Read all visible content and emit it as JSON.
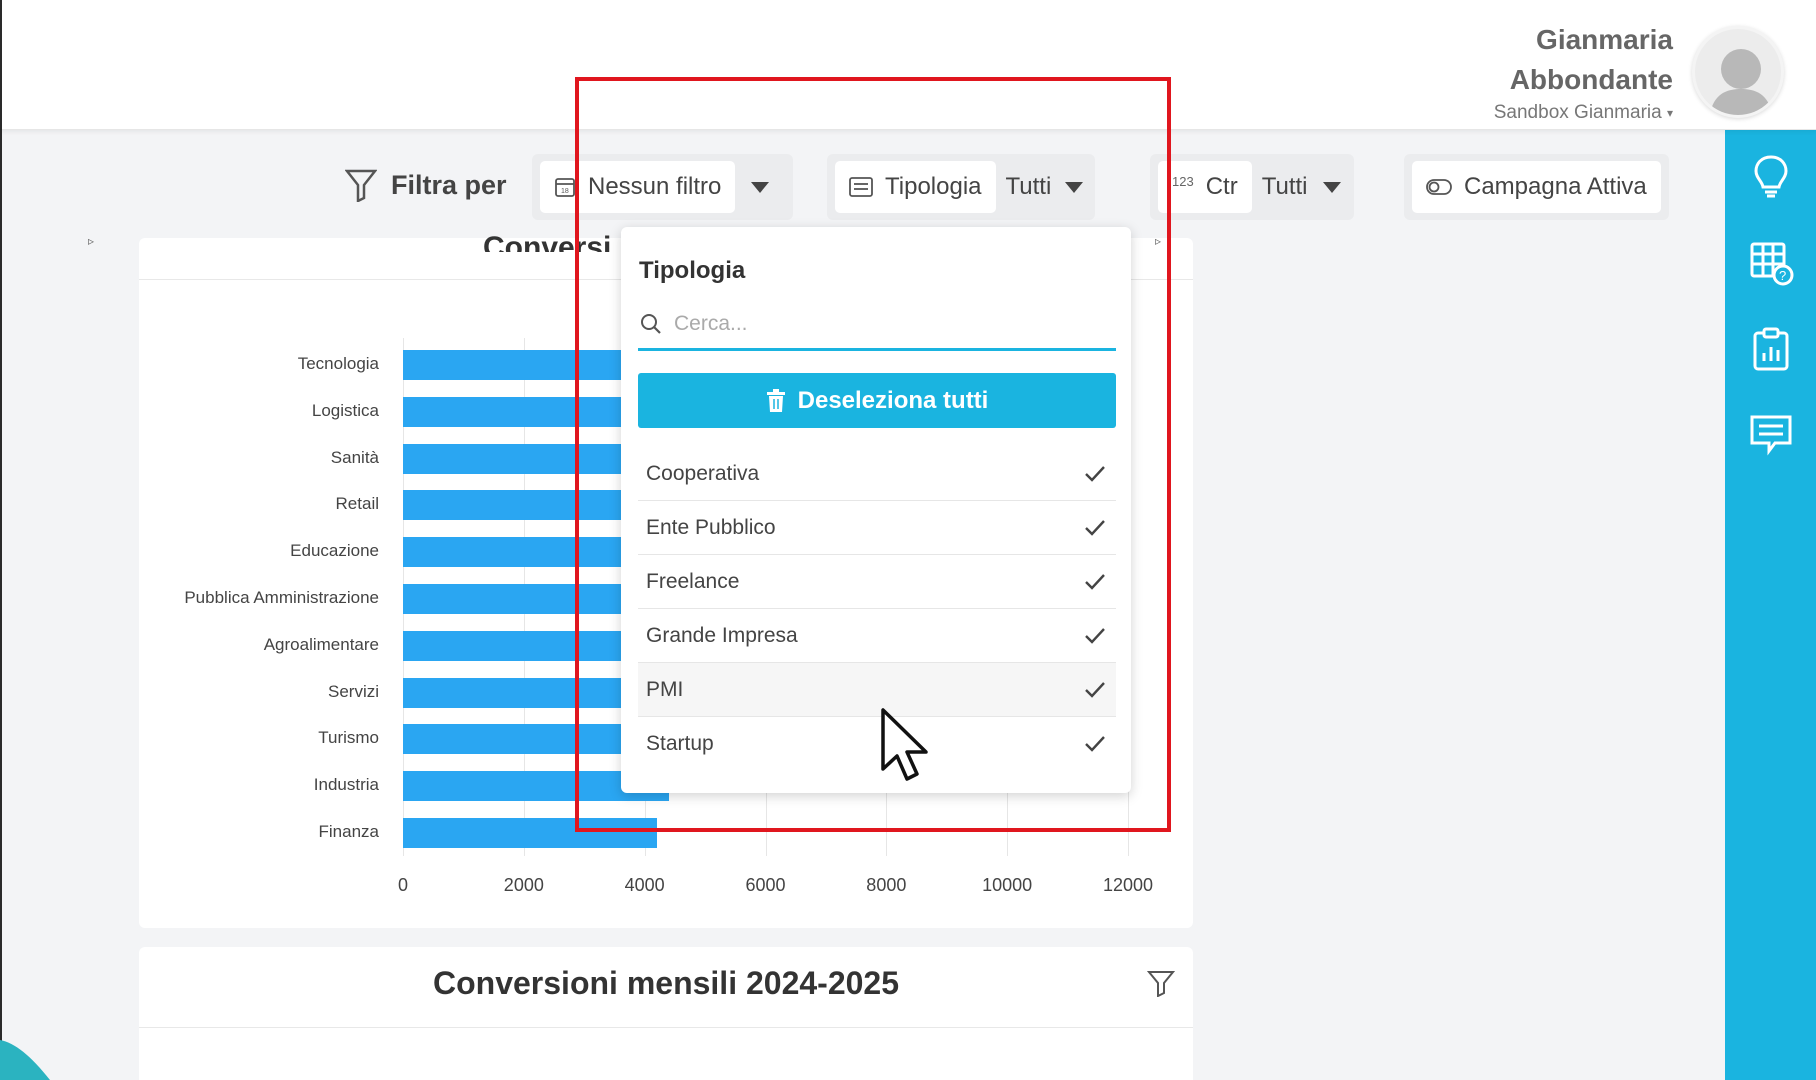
{
  "header": {
    "user_first": "Gianmaria",
    "user_last": "Abbondante",
    "workspace": "Sandbox Gianmaria"
  },
  "filterbar": {
    "label": "Filtra per",
    "date_filter": "Nessun filtro",
    "tipologia_label": "Tipologia",
    "tipologia_value": "Tutti",
    "ctr_prefix": "123",
    "ctr_label": "Ctr",
    "ctr_value": "Tutti",
    "campagna_label": "Campagna Attiva"
  },
  "icons": {
    "filter": "filter-icon",
    "calendar": "calendar-icon",
    "list": "list-icon",
    "toggle": "toggle-icon",
    "bulb": "lightbulb-icon",
    "table": "table-help-icon",
    "report": "clipboard-chart-icon",
    "chat": "chat-icon",
    "trash": "trash-icon",
    "search": "search-icon",
    "check": "check-icon"
  },
  "colors": {
    "accent": "#1ab4e0",
    "bar": "#2aa6f2",
    "annotation": "#e0161e"
  },
  "chart1": {
    "title_visible": "Conversi"
  },
  "chart_data": {
    "type": "bar",
    "orientation": "horizontal",
    "categories": [
      "Tecnologia",
      "Logistica",
      "Sanità",
      "Retail",
      "Educazione",
      "Pubblica Amministrazione",
      "Agroalimentare",
      "Servizi",
      "Turismo",
      "Industria",
      "Finanza"
    ],
    "x_ticks": [
      "0",
      "2000",
      "4000",
      "6000",
      "8000",
      "10000",
      "12000"
    ],
    "xlim": [
      0,
      12000
    ],
    "values_note": "",
    "visible_values": [
      null,
      null,
      null,
      null,
      null,
      null,
      null,
      null,
      null,
      4400,
      4200
    ],
    "grid": false
  },
  "chart2": {
    "title": "Conversioni mensili 2024-2025"
  },
  "dropdown": {
    "title": "Tipologia",
    "search_placeholder": "Cerca...",
    "deselect_label": "Deseleziona tutti",
    "items": [
      {
        "label": "Cooperativa",
        "checked": true
      },
      {
        "label": "Ente Pubblico",
        "checked": true
      },
      {
        "label": "Freelance",
        "checked": true
      },
      {
        "label": "Grande Impresa",
        "checked": true
      },
      {
        "label": "PMI",
        "checked": true
      },
      {
        "label": "Startup",
        "checked": true
      }
    ]
  }
}
